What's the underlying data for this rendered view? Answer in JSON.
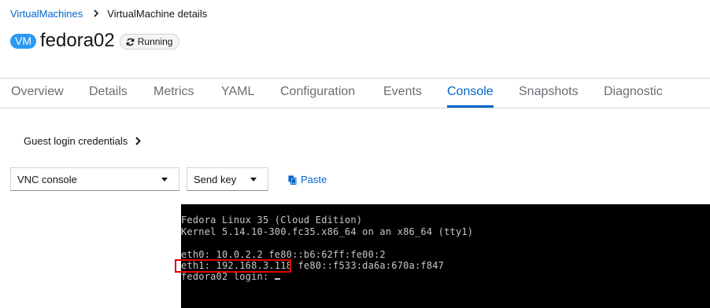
{
  "breadcrumb": {
    "parent": "VirtualMachines",
    "current": "VirtualMachine details"
  },
  "vm": {
    "badge": "VM",
    "name": "fedora02",
    "status": "Running"
  },
  "tabs": [
    {
      "label": "Overview"
    },
    {
      "label": "Details"
    },
    {
      "label": "Metrics"
    },
    {
      "label": "YAML"
    },
    {
      "label": "Configuration"
    },
    {
      "label": "Events"
    },
    {
      "label": "Console",
      "active": true
    },
    {
      "label": "Snapshots"
    },
    {
      "label": "Diagnostic"
    }
  ],
  "guest_credentials": {
    "label": "Guest login credentials"
  },
  "toolbar": {
    "console_select": "VNC console",
    "send_key_select": "Send key",
    "paste_label": "Paste"
  },
  "console": {
    "lines": [
      "Fedora Linux 35 (Cloud Edition)",
      "Kernel 5.14.10-300.fc35.x86_64 on an x86_64 (tty1)",
      "",
      "eth0: 10.0.2.2 fe80::b6:62ff:fe00:2",
      "eth1: 192.168.3.118 fe80::f533:da6a:670a:f847",
      "fedora02 login: "
    ]
  },
  "colors": {
    "accent": "#0066cc",
    "badge": "#2b9af3",
    "highlight": "#e00000",
    "console_bg": "#000000"
  },
  "icons": {
    "breadcrumb_separator": "chevron-right-icon",
    "status": "sync-icon",
    "expand": "chevron-right-icon",
    "dropdown": "caret-down-icon",
    "paste": "copy-icon"
  }
}
